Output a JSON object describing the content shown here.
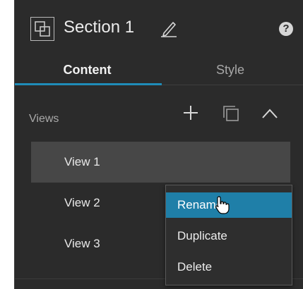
{
  "header": {
    "title": "Section 1",
    "section_icon": "section-frame-icon",
    "edit_icon": "pencil-icon",
    "help_icon": "help-icon",
    "help_label": "?"
  },
  "tabs": [
    {
      "label": "Content",
      "active": true
    },
    {
      "label": "Style",
      "active": false
    }
  ],
  "views": {
    "label": "Views",
    "actions": [
      "add-icon",
      "duplicate-icon",
      "collapse-icon"
    ],
    "items": [
      {
        "label": "View 1",
        "selected": true
      },
      {
        "label": "View 2",
        "selected": false
      },
      {
        "label": "View 3",
        "selected": false
      }
    ]
  },
  "context_menu": {
    "items": [
      {
        "label": "Rename",
        "highlighted": true
      },
      {
        "label": "Duplicate",
        "highlighted": false
      },
      {
        "label": "Delete",
        "highlighted": false
      }
    ]
  },
  "colors": {
    "panel_bg": "#2b2b2b",
    "accent": "#1f8cb8",
    "selected_row": "#474747",
    "menu_highlight": "#1f7fa8"
  }
}
